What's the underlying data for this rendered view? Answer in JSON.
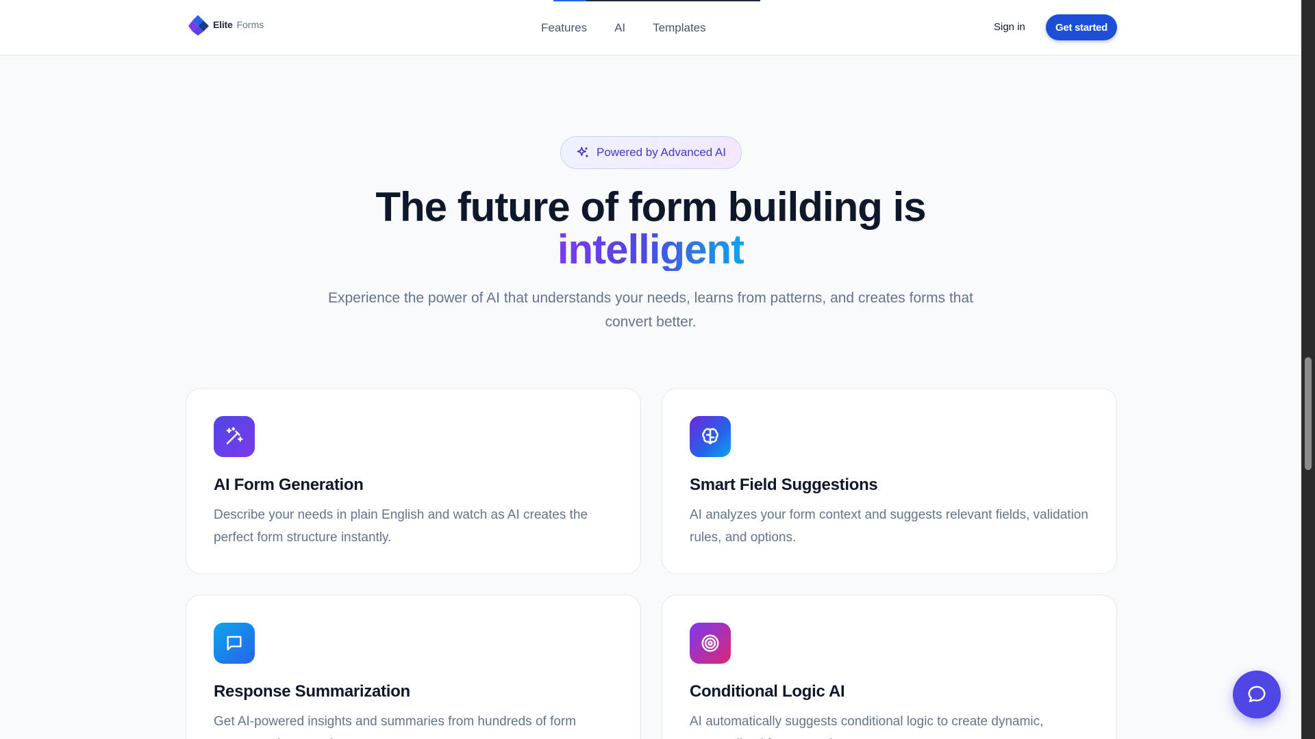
{
  "header": {
    "logo_primary": "Elite",
    "logo_secondary": "Forms",
    "nav": [
      "Features",
      "AI",
      "Templates"
    ],
    "sign_in": "Sign in",
    "get_started": "Get started",
    "scroll_progress_fraction": 0.16
  },
  "hero": {
    "badge": "Powered by Advanced AI",
    "title_line1": "The future of form building is",
    "title_line2": "intelligent",
    "subtitle": "Experience the power of AI that understands your needs, learns from patterns, and creates forms that convert better."
  },
  "features": [
    {
      "icon": "magic-wand-icon",
      "title": "AI Form Generation",
      "description": "Describe your needs in plain English and watch as AI creates the perfect form structure instantly."
    },
    {
      "icon": "brain-icon",
      "title": "Smart Field Suggestions",
      "description": "AI analyzes your form context and suggests relevant fields, validation rules, and options."
    },
    {
      "icon": "message-square-icon",
      "title": "Response Summarization",
      "description": "Get AI-powered insights and summaries from hundreds of form responses in seconds."
    },
    {
      "icon": "target-icon",
      "title": "Conditional Logic AI",
      "description": "AI automatically suggests conditional logic to create dynamic, personalized form experiences."
    }
  ],
  "colors": {
    "primary": "#1d4ed8",
    "accent": "#4f46e5",
    "text": "#0f172a",
    "muted": "#64748b"
  }
}
